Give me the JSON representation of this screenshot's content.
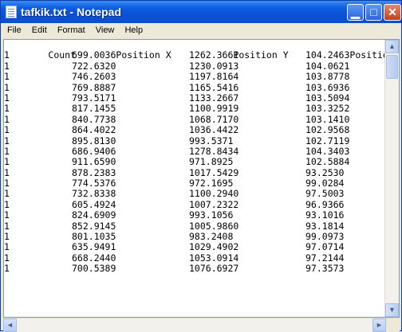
{
  "window": {
    "title": "tafkik.txt - Notepad",
    "controls": {
      "minimize": "▁",
      "maximize": "□",
      "close": "✕"
    }
  },
  "menu": [
    "File",
    "Edit",
    "Format",
    "View",
    "Help"
  ],
  "columns": [
    "Count",
    "Position X",
    "Position Y",
    "Position Z"
  ],
  "rows": [
    [
      "1",
      "699.0036",
      "1262.3661",
      "104.2463"
    ],
    [
      "1",
      "722.6320",
      "1230.0913",
      "104.0621"
    ],
    [
      "1",
      "746.2603",
      "1197.8164",
      "103.8778"
    ],
    [
      "1",
      "769.8887",
      "1165.5416",
      "103.6936"
    ],
    [
      "1",
      "793.5171",
      "1133.2667",
      "103.5094"
    ],
    [
      "1",
      "817.1455",
      "1100.9919",
      "103.3252"
    ],
    [
      "1",
      "840.7738",
      "1068.7170",
      "103.1410"
    ],
    [
      "1",
      "864.4022",
      "1036.4422",
      "102.9568"
    ],
    [
      "1",
      "895.8130",
      "993.5371",
      "102.7119"
    ],
    [
      "1",
      "686.9406",
      "1278.8434",
      "104.3403"
    ],
    [
      "1",
      "911.6590",
      "971.8925",
      "102.5884"
    ],
    [
      "1",
      "878.2383",
      "1017.5429",
      "93.2530"
    ],
    [
      "1",
      "774.5376",
      "972.1695",
      "99.0284"
    ],
    [
      "1",
      "732.8338",
      "1100.2940",
      "97.5003"
    ],
    [
      "1",
      "605.4924",
      "1007.2322",
      "96.9366"
    ],
    [
      "1",
      "824.6909",
      "993.1056",
      "93.1016"
    ],
    [
      "1",
      "852.9145",
      "1005.9860",
      "93.1814"
    ],
    [
      "1",
      "801.1035",
      "983.2408",
      "99.0973"
    ],
    [
      "1",
      "635.9491",
      "1029.4902",
      "97.0714"
    ],
    [
      "1",
      "668.2440",
      "1053.0914",
      "97.2144"
    ],
    [
      "1",
      "700.5389",
      "1076.6927",
      "97.3573"
    ]
  ],
  "scrollbar": {
    "up": "▲",
    "down": "▼",
    "left": "◄",
    "right": "►"
  }
}
